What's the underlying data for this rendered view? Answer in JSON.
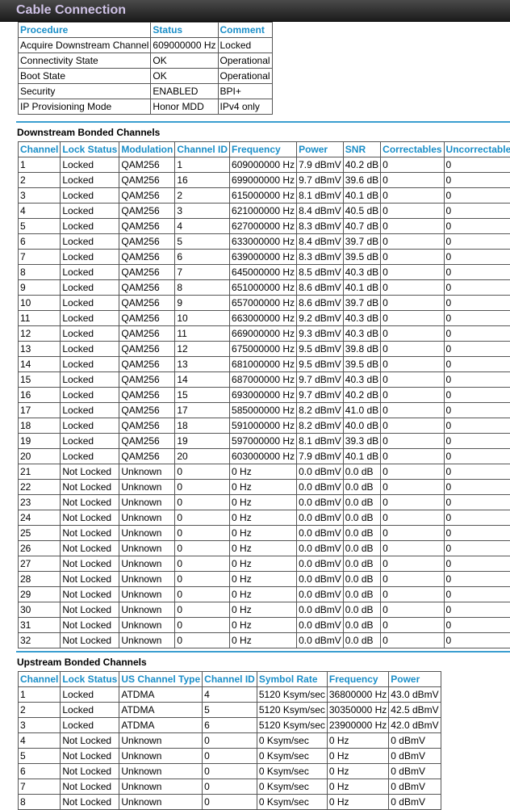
{
  "window": {
    "title": "Cable Connection"
  },
  "procedure_table": {
    "headers": [
      "Procedure",
      "Status",
      "Comment"
    ],
    "rows": [
      [
        "Acquire Downstream Channel",
        "609000000 Hz",
        "Locked"
      ],
      [
        "Connectivity State",
        "OK",
        "Operational"
      ],
      [
        "Boot State",
        "OK",
        "Operational"
      ],
      [
        "Security",
        "ENABLED",
        "BPI+"
      ],
      [
        "IP Provisioning Mode",
        "Honor MDD",
        "IPv4 only"
      ]
    ]
  },
  "downstream": {
    "title": "Downstream Bonded Channels",
    "headers": [
      "Channel",
      "Lock Status",
      "Modulation",
      "Channel ID",
      "Frequency",
      "Power",
      "SNR",
      "Correctables",
      "Uncorrectables"
    ],
    "rows": [
      [
        "1",
        "Locked",
        "QAM256",
        "1",
        "609000000 Hz",
        "7.9 dBmV",
        "40.2 dB",
        "0",
        "0"
      ],
      [
        "2",
        "Locked",
        "QAM256",
        "16",
        "699000000 Hz",
        "9.7 dBmV",
        "39.6 dB",
        "0",
        "0"
      ],
      [
        "3",
        "Locked",
        "QAM256",
        "2",
        "615000000 Hz",
        "8.1 dBmV",
        "40.1 dB",
        "0",
        "0"
      ],
      [
        "4",
        "Locked",
        "QAM256",
        "3",
        "621000000 Hz",
        "8.4 dBmV",
        "40.5 dB",
        "0",
        "0"
      ],
      [
        "5",
        "Locked",
        "QAM256",
        "4",
        "627000000 Hz",
        "8.3 dBmV",
        "40.7 dB",
        "0",
        "0"
      ],
      [
        "6",
        "Locked",
        "QAM256",
        "5",
        "633000000 Hz",
        "8.4 dBmV",
        "39.7 dB",
        "0",
        "0"
      ],
      [
        "7",
        "Locked",
        "QAM256",
        "6",
        "639000000 Hz",
        "8.3 dBmV",
        "39.5 dB",
        "0",
        "0"
      ],
      [
        "8",
        "Locked",
        "QAM256",
        "7",
        "645000000 Hz",
        "8.5 dBmV",
        "40.3 dB",
        "0",
        "0"
      ],
      [
        "9",
        "Locked",
        "QAM256",
        "8",
        "651000000 Hz",
        "8.6 dBmV",
        "40.1 dB",
        "0",
        "0"
      ],
      [
        "10",
        "Locked",
        "QAM256",
        "9",
        "657000000 Hz",
        "8.6 dBmV",
        "39.7 dB",
        "0",
        "0"
      ],
      [
        "11",
        "Locked",
        "QAM256",
        "10",
        "663000000 Hz",
        "9.2 dBmV",
        "40.3 dB",
        "0",
        "0"
      ],
      [
        "12",
        "Locked",
        "QAM256",
        "11",
        "669000000 Hz",
        "9.3 dBmV",
        "40.3 dB",
        "0",
        "0"
      ],
      [
        "13",
        "Locked",
        "QAM256",
        "12",
        "675000000 Hz",
        "9.5 dBmV",
        "39.8 dB",
        "0",
        "0"
      ],
      [
        "14",
        "Locked",
        "QAM256",
        "13",
        "681000000 Hz",
        "9.5 dBmV",
        "39.5 dB",
        "0",
        "0"
      ],
      [
        "15",
        "Locked",
        "QAM256",
        "14",
        "687000000 Hz",
        "9.7 dBmV",
        "40.3 dB",
        "0",
        "0"
      ],
      [
        "16",
        "Locked",
        "QAM256",
        "15",
        "693000000 Hz",
        "9.7 dBmV",
        "40.2 dB",
        "0",
        "0"
      ],
      [
        "17",
        "Locked",
        "QAM256",
        "17",
        "585000000 Hz",
        "8.2 dBmV",
        "41.0 dB",
        "0",
        "0"
      ],
      [
        "18",
        "Locked",
        "QAM256",
        "18",
        "591000000 Hz",
        "8.2 dBmV",
        "40.0 dB",
        "0",
        "0"
      ],
      [
        "19",
        "Locked",
        "QAM256",
        "19",
        "597000000 Hz",
        "8.1 dBmV",
        "39.3 dB",
        "0",
        "0"
      ],
      [
        "20",
        "Locked",
        "QAM256",
        "20",
        "603000000 Hz",
        "7.9 dBmV",
        "40.1 dB",
        "0",
        "0"
      ],
      [
        "21",
        "Not Locked",
        "Unknown",
        "0",
        "0 Hz",
        "0.0 dBmV",
        "0.0 dB",
        "0",
        "0"
      ],
      [
        "22",
        "Not Locked",
        "Unknown",
        "0",
        "0 Hz",
        "0.0 dBmV",
        "0.0 dB",
        "0",
        "0"
      ],
      [
        "23",
        "Not Locked",
        "Unknown",
        "0",
        "0 Hz",
        "0.0 dBmV",
        "0.0 dB",
        "0",
        "0"
      ],
      [
        "24",
        "Not Locked",
        "Unknown",
        "0",
        "0 Hz",
        "0.0 dBmV",
        "0.0 dB",
        "0",
        "0"
      ],
      [
        "25",
        "Not Locked",
        "Unknown",
        "0",
        "0 Hz",
        "0.0 dBmV",
        "0.0 dB",
        "0",
        "0"
      ],
      [
        "26",
        "Not Locked",
        "Unknown",
        "0",
        "0 Hz",
        "0.0 dBmV",
        "0.0 dB",
        "0",
        "0"
      ],
      [
        "27",
        "Not Locked",
        "Unknown",
        "0",
        "0 Hz",
        "0.0 dBmV",
        "0.0 dB",
        "0",
        "0"
      ],
      [
        "28",
        "Not Locked",
        "Unknown",
        "0",
        "0 Hz",
        "0.0 dBmV",
        "0.0 dB",
        "0",
        "0"
      ],
      [
        "29",
        "Not Locked",
        "Unknown",
        "0",
        "0 Hz",
        "0.0 dBmV",
        "0.0 dB",
        "0",
        "0"
      ],
      [
        "30",
        "Not Locked",
        "Unknown",
        "0",
        "0 Hz",
        "0.0 dBmV",
        "0.0 dB",
        "0",
        "0"
      ],
      [
        "31",
        "Not Locked",
        "Unknown",
        "0",
        "0 Hz",
        "0.0 dBmV",
        "0.0 dB",
        "0",
        "0"
      ],
      [
        "32",
        "Not Locked",
        "Unknown",
        "0",
        "0 Hz",
        "0.0 dBmV",
        "0.0 dB",
        "0",
        "0"
      ]
    ]
  },
  "upstream": {
    "title": "Upstream Bonded Channels",
    "headers": [
      "Channel",
      "Lock Status",
      "US Channel Type",
      "Channel ID",
      "Symbol Rate",
      "Frequency",
      "Power"
    ],
    "rows": [
      [
        "1",
        "Locked",
        "ATDMA",
        "4",
        "5120 Ksym/sec",
        "36800000 Hz",
        "43.0 dBmV"
      ],
      [
        "2",
        "Locked",
        "ATDMA",
        "5",
        "5120 Ksym/sec",
        "30350000 Hz",
        "42.5 dBmV"
      ],
      [
        "3",
        "Locked",
        "ATDMA",
        "6",
        "5120 Ksym/sec",
        "23900000 Hz",
        "42.0 dBmV"
      ],
      [
        "4",
        "Not Locked",
        "Unknown",
        "0",
        "0 Ksym/sec",
        "0 Hz",
        "0 dBmV"
      ],
      [
        "5",
        "Not Locked",
        "Unknown",
        "0",
        "0 Ksym/sec",
        "0 Hz",
        "0 dBmV"
      ],
      [
        "6",
        "Not Locked",
        "Unknown",
        "0",
        "0 Ksym/sec",
        "0 Hz",
        "0 dBmV"
      ],
      [
        "7",
        "Not Locked",
        "Unknown",
        "0",
        "0 Ksym/sec",
        "0 Hz",
        "0 dBmV"
      ],
      [
        "8",
        "Not Locked",
        "Unknown",
        "0",
        "0 Ksym/sec",
        "0 Hz",
        "0 dBmV"
      ]
    ]
  },
  "colors": {
    "header_text": "#1a8ec8",
    "rule": "#3a9ed0",
    "title_text": "#cfc2e6"
  }
}
